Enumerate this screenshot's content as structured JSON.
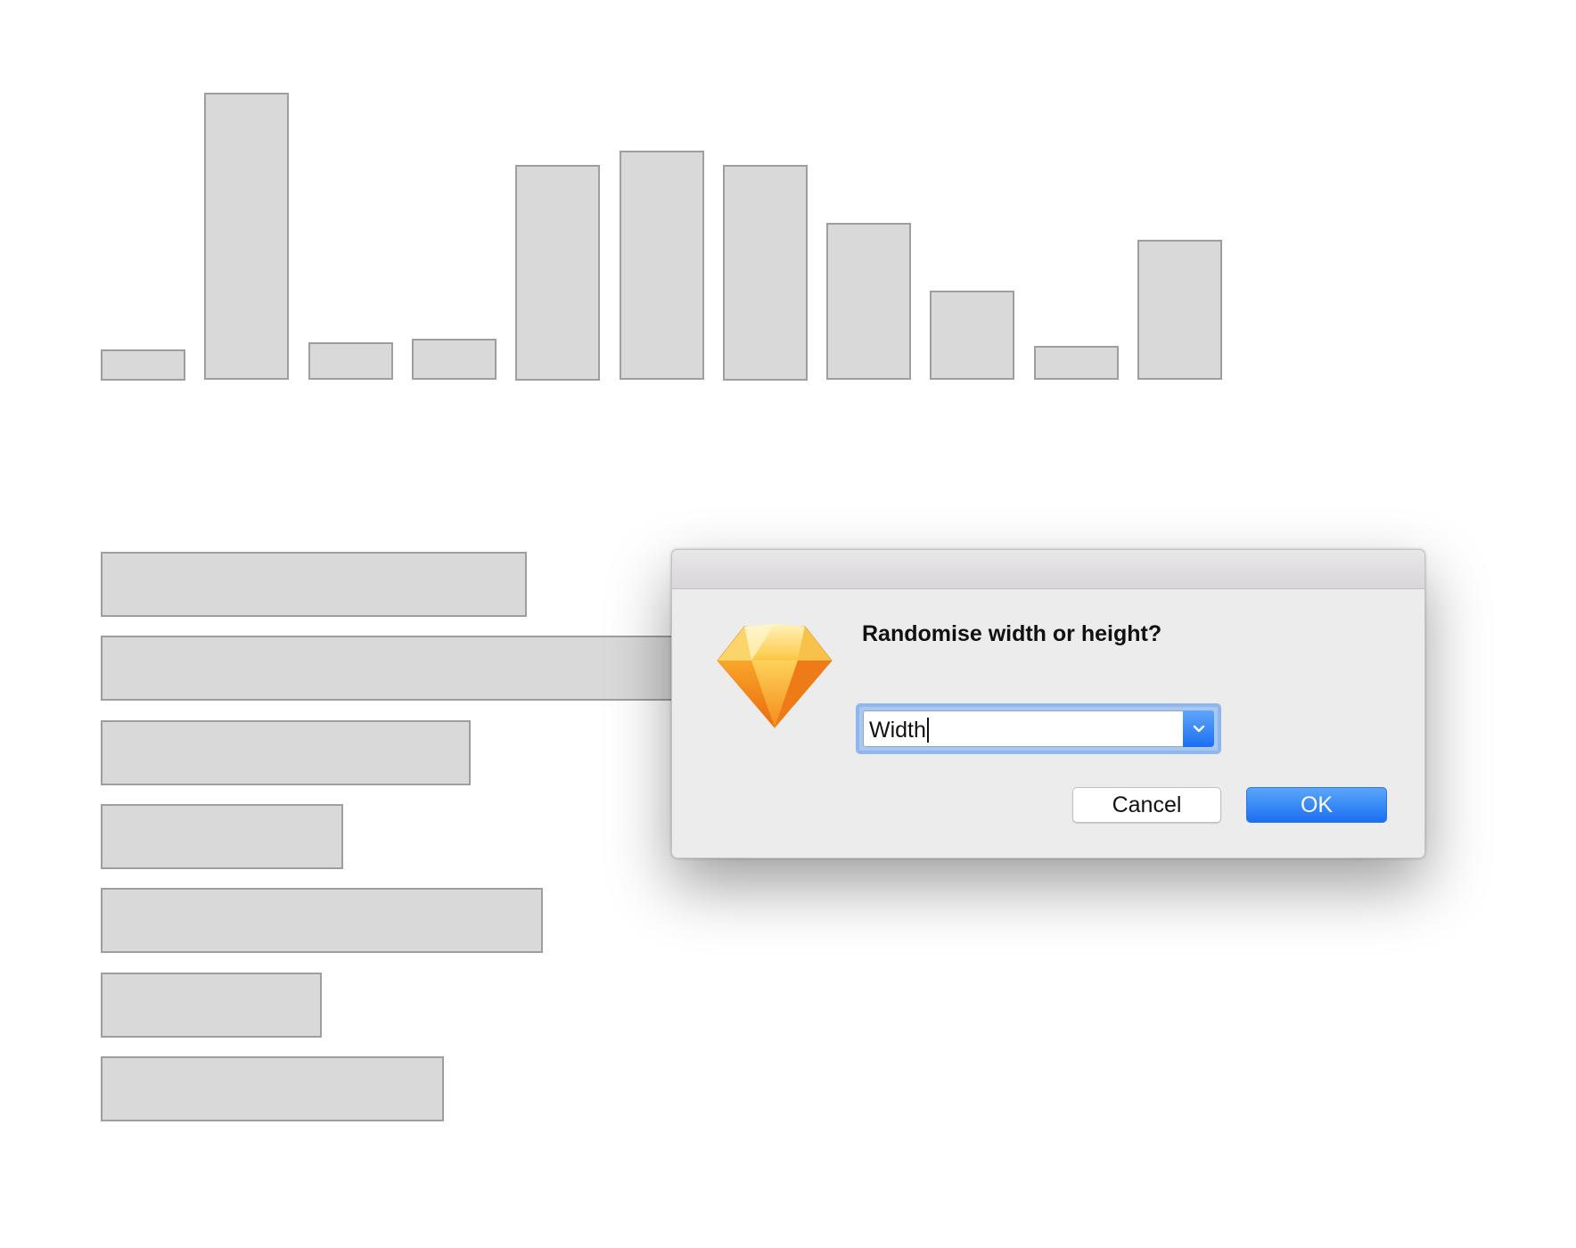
{
  "canvas": {
    "bar_values": [
      9,
      84,
      11,
      12,
      63,
      67,
      63,
      46,
      26,
      10,
      41
    ],
    "horizontal_bar_values": [
      478,
      646,
      415,
      272,
      496,
      248,
      385
    ],
    "fill_color": "#d9d9d9",
    "stroke_color": "#9e9e9e"
  },
  "dialog": {
    "icon": "sketch-diamond-icon",
    "message": "Randomise width or height?",
    "combo_value": "Width",
    "cancel_label": "Cancel",
    "ok_label": "OK",
    "accent_color": "#1c6ff0"
  }
}
